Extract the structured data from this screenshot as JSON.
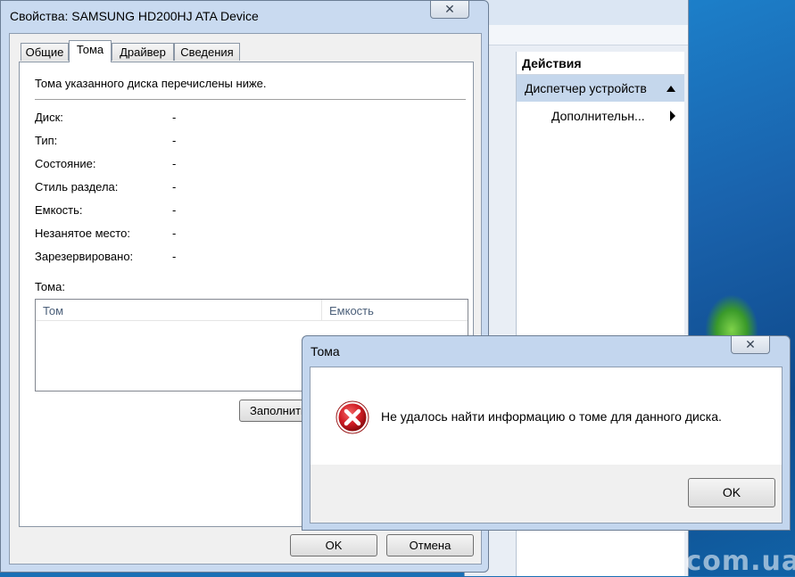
{
  "properties_dialog": {
    "title": "Свойства: SAMSUNG HD200HJ ATA Device",
    "close_glyph": "✕",
    "tabs": [
      {
        "label": "Общие",
        "active": false
      },
      {
        "label": "Тома",
        "active": true
      },
      {
        "label": "Драйвер",
        "active": false
      },
      {
        "label": "Сведения",
        "active": false
      }
    ],
    "intro_text": "Тома указанного диска перечислены ниже.",
    "fields": [
      {
        "label": "Диск:",
        "value": "-"
      },
      {
        "label": "Тип:",
        "value": "-"
      },
      {
        "label": "Состояние:",
        "value": "-"
      },
      {
        "label": "Стиль раздела:",
        "value": "-"
      },
      {
        "label": "Емкость:",
        "value": "-"
      },
      {
        "label": "Незанятое место:",
        "value": "-"
      },
      {
        "label": "Зарезервировано:",
        "value": "-"
      }
    ],
    "volumes_label": "Тома:",
    "volumes_columns": [
      "Том",
      "Емкость"
    ],
    "fill_button": "Заполнить",
    "ok_button": "OK",
    "cancel_button": "Отмена"
  },
  "device_manager": {
    "actions_header": "Действия",
    "actions_group": "Диспетчер устройств",
    "actions_item": "Дополнительн..."
  },
  "message_box": {
    "title": "Тома",
    "close_glyph": "✕",
    "icon": "error-icon",
    "text": "Не удалось найти информацию о томе для данного диска.",
    "ok_button": "OK"
  },
  "watermark": "easywork.com.ua",
  "colors": {
    "error_red": "#c8102e",
    "selection_blue": "#c5d7ec"
  }
}
